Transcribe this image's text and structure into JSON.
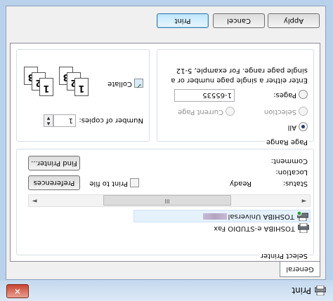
{
  "window": {
    "title": "Print",
    "close_label": "✕"
  },
  "tabs": [
    {
      "label": "General"
    }
  ],
  "select_printer": {
    "label": "Select Printer",
    "printers": [
      {
        "name": "TOSHIBA e-STUDIO Fax"
      },
      {
        "name": "TOSHIBA Universal"
      }
    ],
    "status_label": "Status:",
    "status_value": "Ready",
    "location_label": "Location:",
    "location_value": "",
    "comment_label": "Comment:",
    "comment_value": "",
    "print_to_file_label": "Print to file",
    "preferences_label": "Preferences",
    "find_printer_label": "Find Printer...",
    "scroll_thumb_glyph": "III",
    "scroll_left_glyph": "◄",
    "scroll_right_glyph": "►"
  },
  "page_range": {
    "label": "Page Range",
    "all_label": "All",
    "selection_label": "Selection",
    "current_page_label": "Current Page",
    "pages_label": "Pages:",
    "pages_value": "1-65535",
    "hint": "Enter either a single page number or a single page range. For example, 5-12"
  },
  "copies": {
    "number_label": "Number of copies:",
    "number_value": "1",
    "collate_label": "Collate",
    "collate_checked": true,
    "collate_pages": [
      "1",
      "2",
      "3"
    ]
  },
  "buttons": {
    "print": "Print",
    "cancel": "Cancel",
    "apply": "Apply"
  },
  "colors": {
    "frame": "#b9d1ea",
    "close_button": "#c8442f",
    "selection": "#e5f1fb"
  }
}
